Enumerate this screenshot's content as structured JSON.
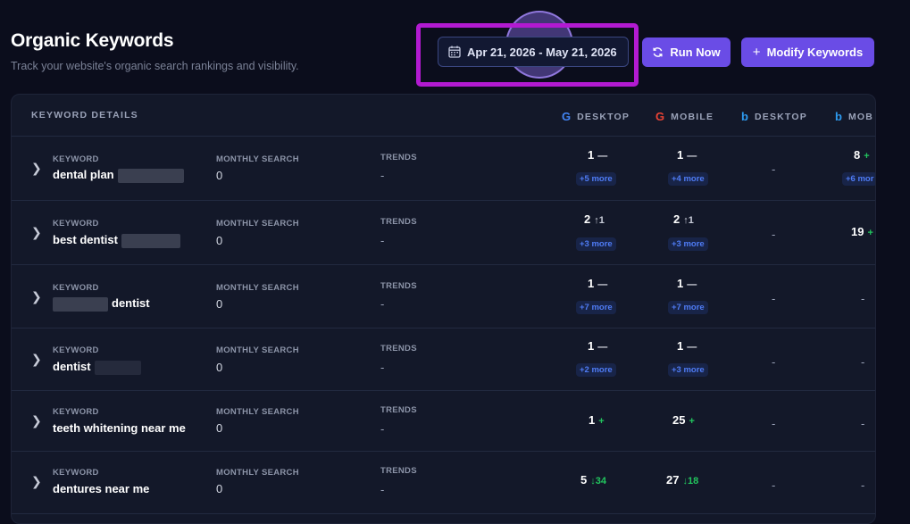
{
  "header": {
    "title": "Organic Keywords",
    "subtitle": "Track your website's organic search rankings and visibility."
  },
  "toolbar": {
    "date_range": "Apr 21, 2026 - May 21, 2026",
    "run_label": "Run Now",
    "modify_label": "Modify Keywords"
  },
  "table": {
    "headers": {
      "details": "KEYWORD DETAILS",
      "google_desktop": "DESKTOP",
      "google_mobile": "MOBILE",
      "bing_desktop": "DESKTOP",
      "bing_mobile": "MOB"
    },
    "field_labels": {
      "keyword": "KEYWORD",
      "monthly_search": "MONTHLY SEARCH",
      "trends": "TRENDS"
    },
    "rows": [
      {
        "keyword": "dental plan",
        "monthly": "0",
        "trend": "-",
        "gd": "1",
        "gd_chg": "—",
        "gd_more": "+5 more",
        "gm": "1",
        "gm_chg": "—",
        "gm_more": "+4 more",
        "bd": "-",
        "bm": "8",
        "bm_chg": "+",
        "bm_more": "+6 mor"
      },
      {
        "keyword": "best dentist",
        "monthly": "0",
        "trend": "-",
        "gd": "2",
        "gd_chg": "↑1",
        "gd_more": "+3 more",
        "gm": "2",
        "gm_chg": "↑1",
        "gm_more": "+3 more",
        "bd": "-",
        "bm": "19",
        "bm_chg": "+",
        "bm_more": ""
      },
      {
        "keyword": "dentist",
        "monthly": "0",
        "trend": "-",
        "gd": "1",
        "gd_chg": "—",
        "gd_more": "+7 more",
        "gm": "1",
        "gm_chg": "—",
        "gm_more": "+7 more",
        "bd": "-",
        "bm": "-",
        "bm_chg": "",
        "bm_more": ""
      },
      {
        "keyword": "dentist",
        "monthly": "0",
        "trend": "-",
        "gd": "1",
        "gd_chg": "—",
        "gd_more": "+2 more",
        "gm": "1",
        "gm_chg": "—",
        "gm_more": "+3 more",
        "bd": "-",
        "bm": "-",
        "bm_chg": "",
        "bm_more": ""
      },
      {
        "keyword": "teeth whitening near me",
        "monthly": "0",
        "trend": "-",
        "gd": "1",
        "gd_chg": "+",
        "gd_more": "",
        "gm": "25",
        "gm_chg": "+",
        "gm_more": "",
        "bd": "-",
        "bm": "-",
        "bm_chg": "",
        "bm_more": ""
      },
      {
        "keyword": "dentures near me",
        "monthly": "0",
        "trend": "-",
        "gd": "5",
        "gd_chg": "↓34",
        "gd_more": "",
        "gm": "27",
        "gm_chg": "↓18",
        "gm_more": "",
        "bd": "-",
        "bm": "-",
        "bm_chg": "",
        "bm_more": ""
      }
    ]
  },
  "colors": {
    "background": "#0b0d1c",
    "card": "#131829",
    "accent": "#6a4ce6",
    "highlight": "#b21ad1",
    "positive": "#22c55e",
    "link": "#4f7cf5"
  },
  "icons": [
    "calendar-icon",
    "refresh-icon",
    "plus-icon",
    "google-icon",
    "bing-icon",
    "chevron-right-icon"
  ]
}
